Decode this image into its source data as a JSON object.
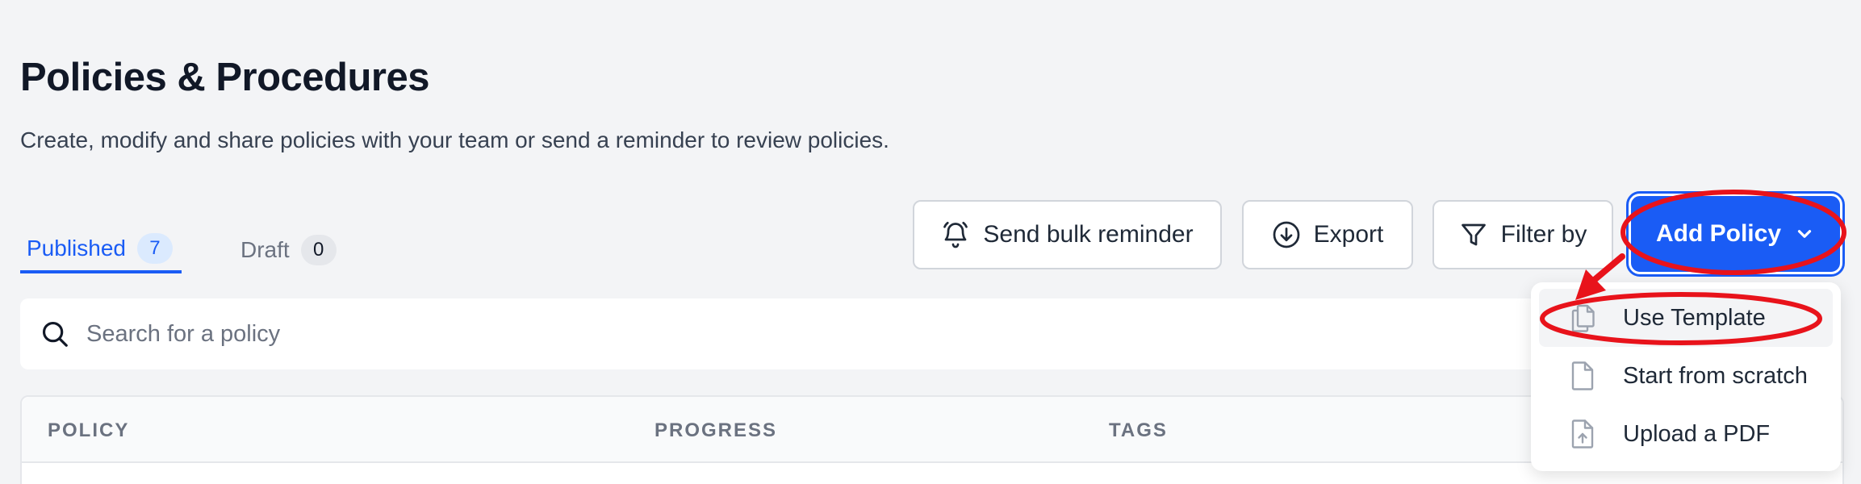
{
  "header": {
    "title": "Policies & Procedures",
    "subtitle": "Create, modify and share policies with your team or send a reminder to review policies."
  },
  "tabs": [
    {
      "label": "Published",
      "count": "7",
      "active": true
    },
    {
      "label": "Draft",
      "count": "0",
      "active": false
    }
  ],
  "toolbar": {
    "bulk_reminder_label": "Send bulk reminder",
    "bulk_reminder_icon": "bell-icon",
    "export_label": "Export",
    "export_icon": "download-circle-icon",
    "filter_label": "Filter by",
    "filter_icon": "funnel-icon",
    "add_policy_label": "Add Policy",
    "add_policy_icon": "chevron-down-icon"
  },
  "search": {
    "placeholder": "Search for a policy",
    "value": ""
  },
  "table": {
    "columns": [
      "POLICY",
      "PROGRESS",
      "TAGS"
    ]
  },
  "add_policy_menu": {
    "items": [
      {
        "label": "Use Template",
        "icon": "copy-documents-icon"
      },
      {
        "label": "Start from scratch",
        "icon": "blank-document-icon"
      },
      {
        "label": "Upload a PDF",
        "icon": "upload-document-icon"
      }
    ]
  },
  "colors": {
    "primary": "#1a5cf5",
    "annotation": "#e8131b",
    "background": "#f3f4f6"
  }
}
